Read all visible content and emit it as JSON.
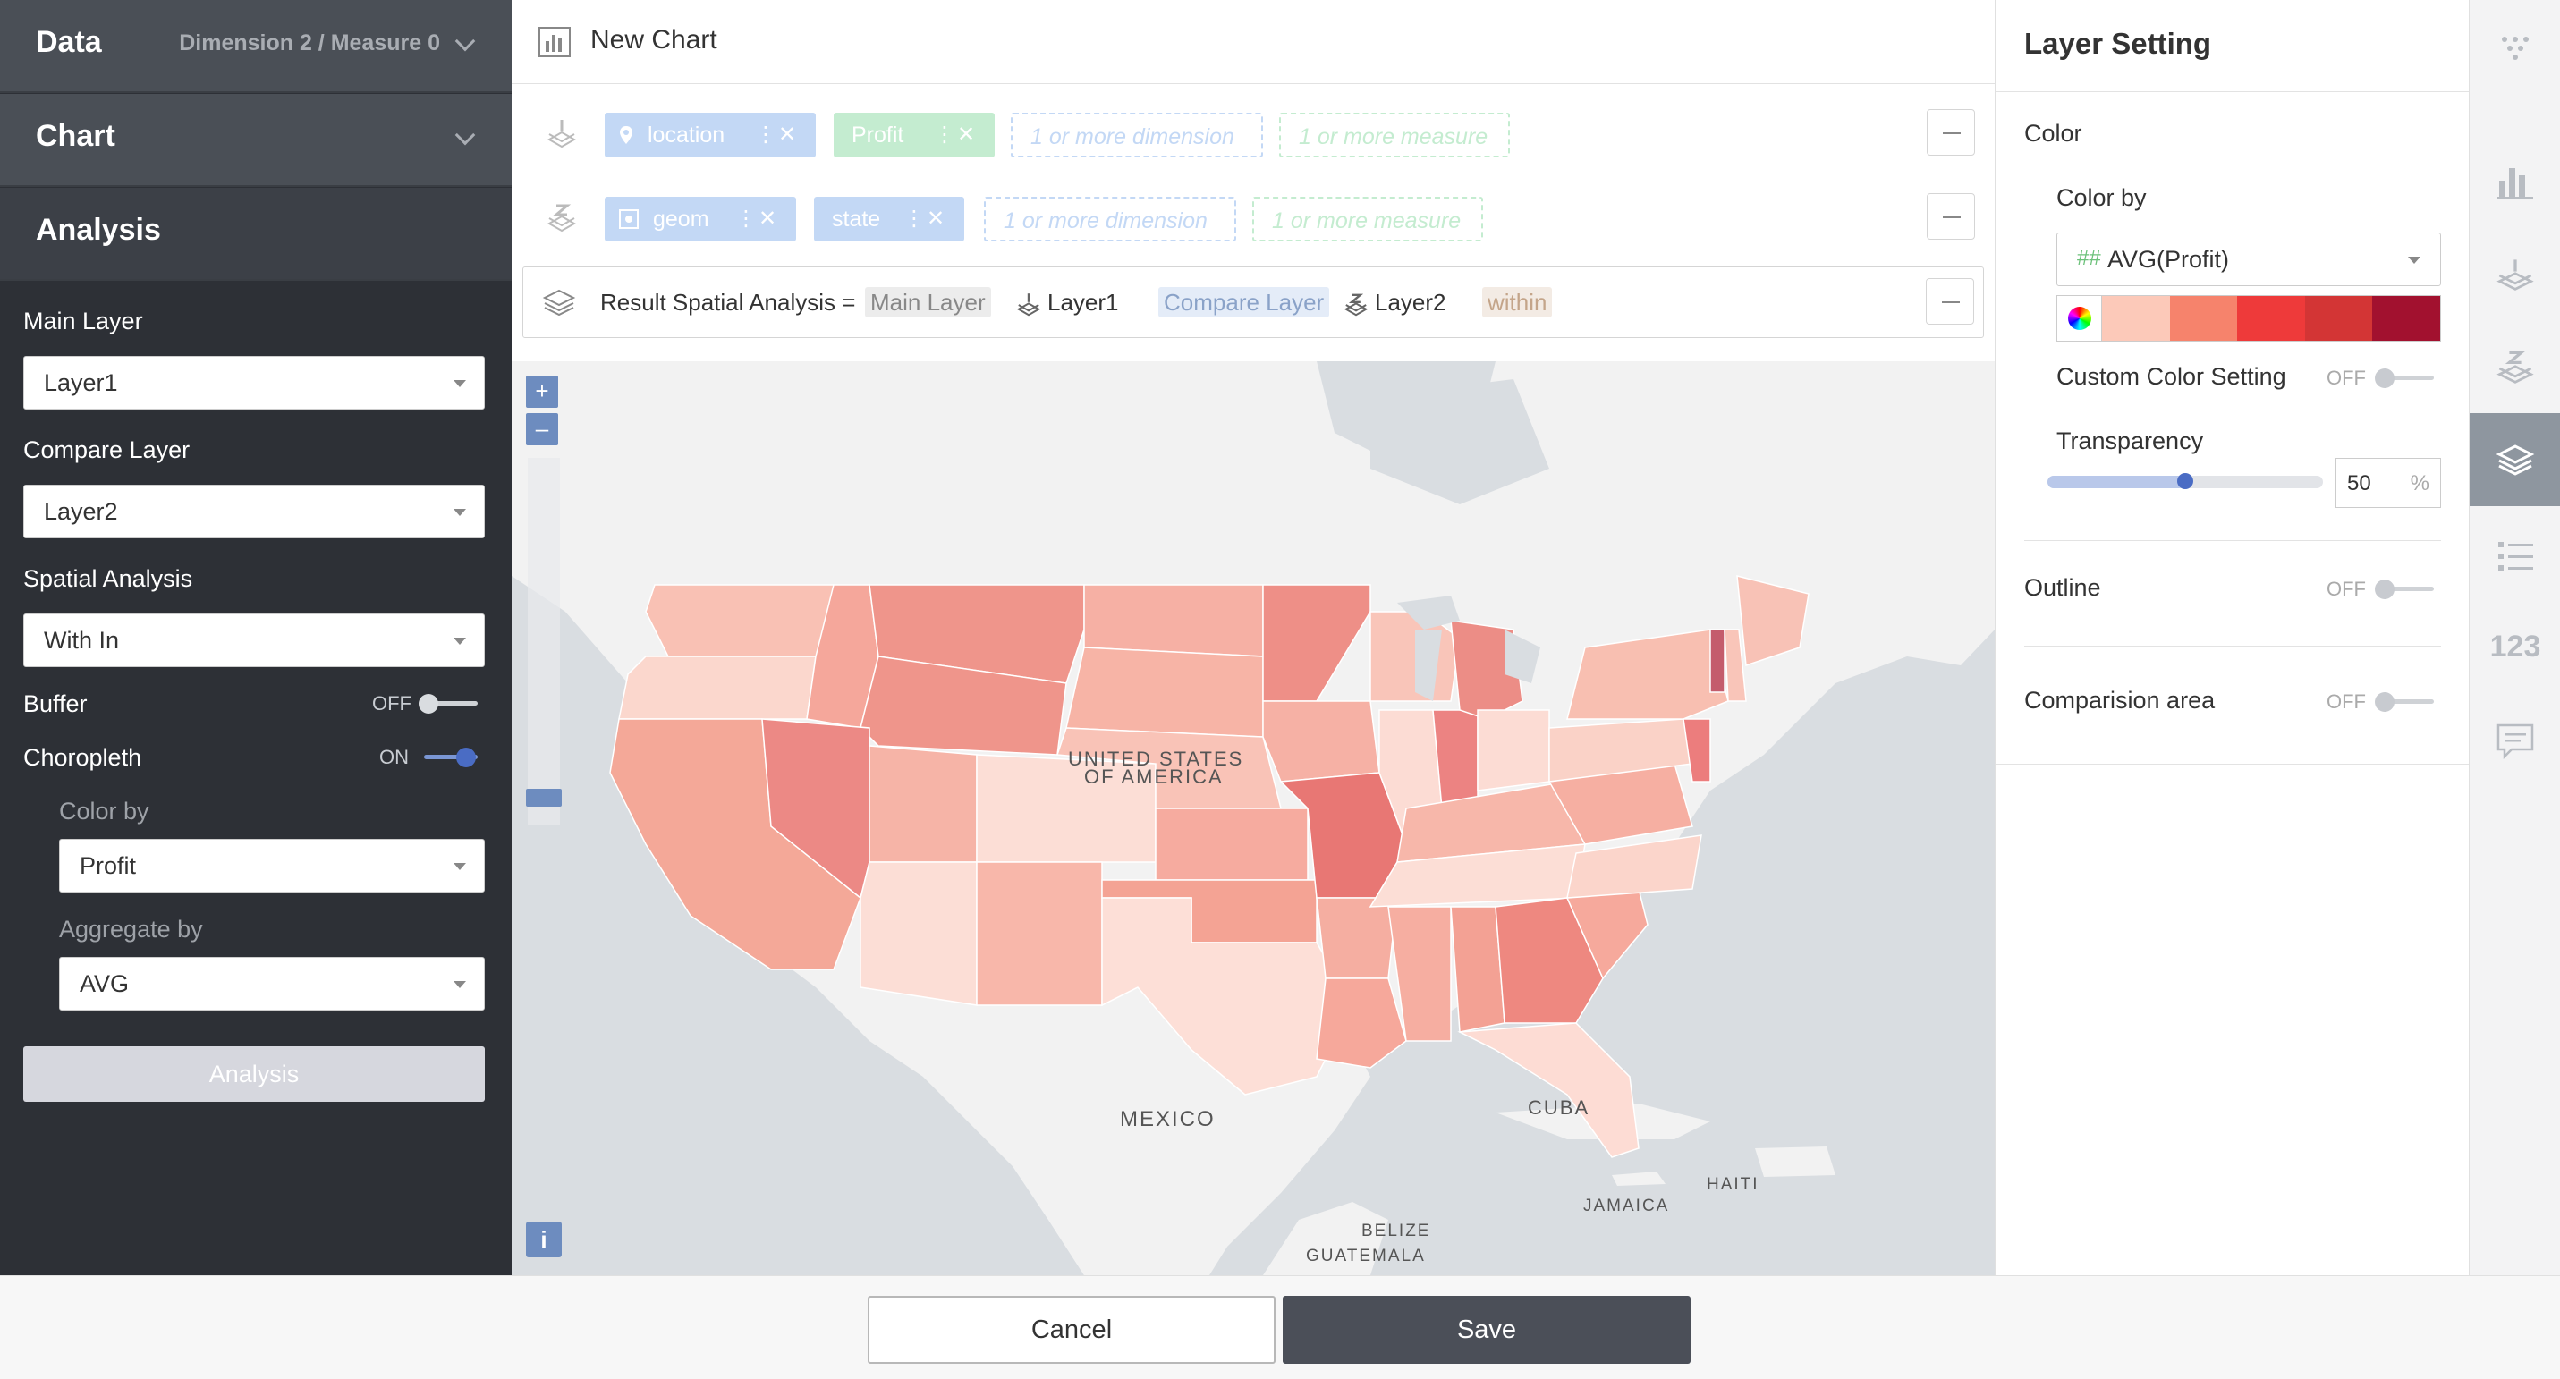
{
  "left_panel": {
    "data_section": {
      "title": "Data",
      "meta": "Dimension 2 / Measure 0"
    },
    "chart_section": {
      "title": "Chart"
    },
    "analysis_section": {
      "title": "Analysis"
    },
    "main_layer": {
      "label": "Main Layer",
      "value": "Layer1"
    },
    "compare_layer": {
      "label": "Compare Layer",
      "value": "Layer2"
    },
    "spatial_analysis": {
      "label": "Spatial Analysis",
      "value": "With In"
    },
    "buffer": {
      "label": "Buffer",
      "state": "OFF"
    },
    "choropleth": {
      "label": "Choropleth",
      "state": "ON"
    },
    "color_by": {
      "label": "Color by",
      "value": "Profit"
    },
    "aggregate_by": {
      "label": "Aggregate by",
      "value": "AVG"
    },
    "analysis_button": "Analysis"
  },
  "center": {
    "chart_title": "New Chart",
    "layer1_row": {
      "pills": [
        "location",
        "Profit"
      ],
      "placeholders": [
        "1 or more dimension",
        "1 or more measure"
      ]
    },
    "layer2_row": {
      "pills": [
        "geom",
        "state"
      ],
      "placeholders": [
        "1 or more dimension",
        "1 or more measure"
      ]
    },
    "result": {
      "prefix": "Result Spatial Analysis =",
      "main_tag": "Main Layer",
      "main_value": "Layer1",
      "compare_tag": "Compare Layer",
      "compare_value": "Layer2",
      "op_tag": "within"
    },
    "map": {
      "zoom_in": "+",
      "zoom_out": "–",
      "info": "i",
      "labels": {
        "usa_1": "UNITED STATES",
        "usa_2": "OF AMERICA",
        "mexico": "MEXICO",
        "cuba": "CUBA",
        "haiti": "HAITI",
        "jamaica": "JAMAICA",
        "belize": "BELIZE",
        "guatemala": "GUATEMALA"
      }
    }
  },
  "right_panel": {
    "title": "Layer Setting",
    "color_section": "Color",
    "color_by_label": "Color by",
    "color_by_value": "AVG(Profit)",
    "color_by_icon": "##",
    "palette": [
      "#fcc9b9",
      "#f6836c",
      "#ee3a3a",
      "#d33535",
      "#a2112f"
    ],
    "custom_color": {
      "label": "Custom Color Setting",
      "state": "OFF"
    },
    "transparency": {
      "label": "Transparency",
      "value": "50",
      "unit": "%",
      "level": 0.5
    },
    "outline": {
      "label": "Outline",
      "state": "OFF"
    },
    "comparison_area": {
      "label": "Comparision area",
      "state": "OFF"
    }
  },
  "rail": {
    "items": [
      "dots-grid-icon",
      "bar-chart-icon",
      "layer1-icon",
      "layer2-icon",
      "layers-icon",
      "list-icon",
      "number-icon",
      "comment-icon"
    ],
    "number_label": "123"
  },
  "footer": {
    "cancel": "Cancel",
    "save": "Save"
  }
}
